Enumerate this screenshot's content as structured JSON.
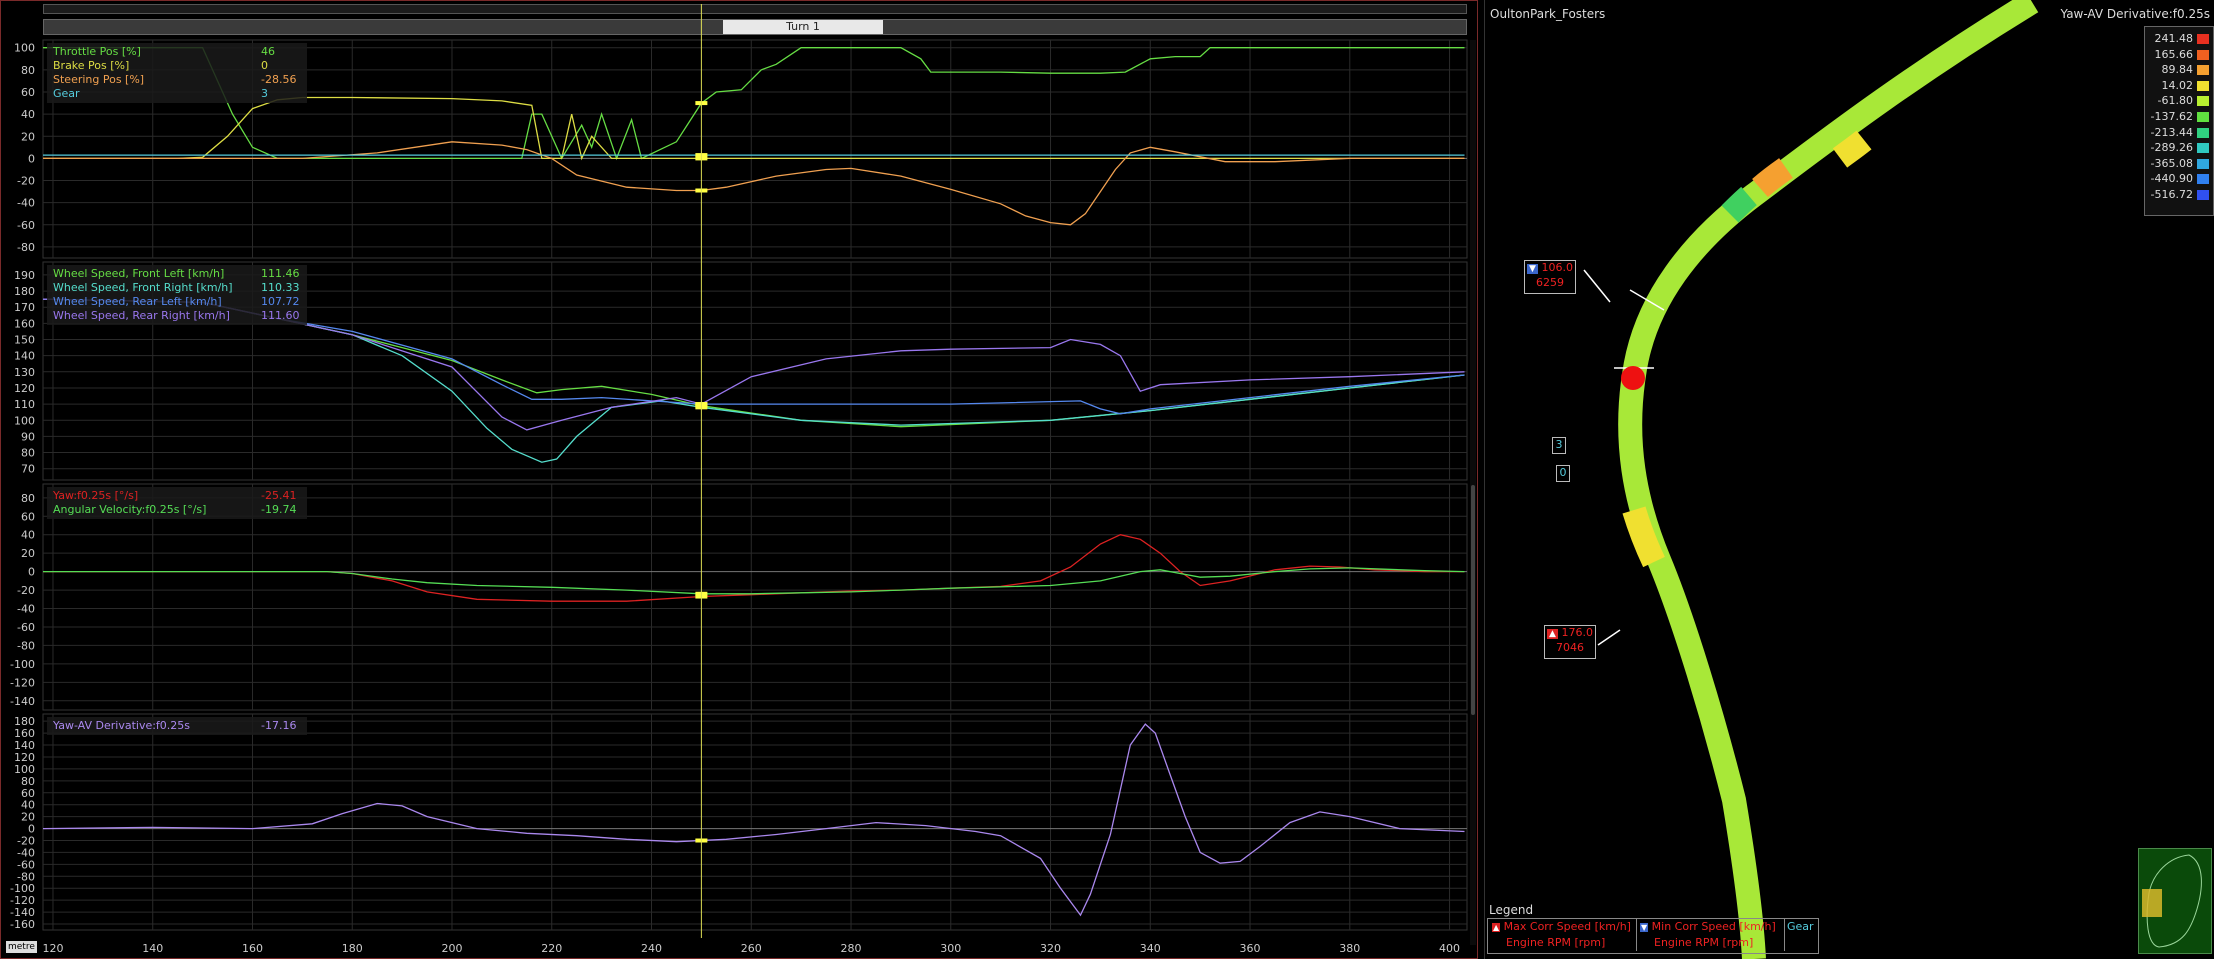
{
  "segment": {
    "label": "Turn 1"
  },
  "unit_label": "metre",
  "x_axis": {
    "ticks": [
      120,
      140,
      160,
      180,
      200,
      220,
      240,
      260,
      280,
      300,
      320,
      340,
      360,
      380,
      400
    ]
  },
  "charts": [
    {
      "id": "inputs",
      "yticks": [
        "100",
        "80",
        "60",
        "40",
        "20",
        "0",
        "-20",
        "-40",
        "-60",
        "-80"
      ],
      "ylim": [
        -90,
        107
      ],
      "legend": [
        {
          "name": "Throttle Pos [%]",
          "value": "46",
          "color": "#66dd44"
        },
        {
          "name": "Brake Pos [%]",
          "value": "0",
          "color": "#dddd44"
        },
        {
          "name": "Steering Pos [%]",
          "value": "-28.56",
          "color": "#f0a050"
        },
        {
          "name": "Gear",
          "value": "3",
          "color": "#55ccdd"
        }
      ],
      "series": [
        {
          "color": "#66dd44",
          "x": [
            118,
            150,
            152,
            156,
            160,
            165,
            168,
            172,
            185,
            200,
            210,
            214,
            216,
            218,
            222,
            226,
            228,
            230,
            233,
            236,
            238,
            245,
            250,
            253,
            258,
            262,
            265,
            270,
            275,
            290,
            294,
            296,
            300,
            310,
            320,
            325,
            330,
            335,
            340,
            345,
            350,
            352,
            360,
            380,
            403
          ],
          "y": [
            100,
            100,
            80,
            40,
            10,
            0,
            0,
            0,
            0,
            0,
            0,
            0,
            40,
            40,
            0,
            30,
            10,
            40,
            0,
            35,
            0,
            15,
            50,
            60,
            62,
            80,
            85,
            100,
            100,
            100,
            90,
            78,
            78,
            78,
            77,
            77,
            77,
            78,
            90,
            92,
            92,
            100,
            100,
            100,
            100
          ]
        },
        {
          "color": "#dddd44",
          "x": [
            118,
            145,
            150,
            155,
            160,
            165,
            170,
            180,
            200,
            210,
            216,
            218,
            222,
            224,
            226,
            228,
            232,
            240,
            250,
            300,
            403
          ],
          "y": [
            0,
            0,
            1,
            20,
            45,
            53,
            55,
            55,
            54,
            52,
            48,
            0,
            0,
            40,
            0,
            20,
            0,
            0,
            0,
            0,
            0
          ]
        },
        {
          "color": "#f0a050",
          "x": [
            118,
            170,
            185,
            200,
            210,
            215,
            220,
            225,
            235,
            245,
            250,
            255,
            265,
            275,
            280,
            290,
            300,
            310,
            315,
            320,
            324,
            327,
            330,
            333,
            336,
            340,
            345,
            355,
            365,
            380,
            403
          ],
          "y": [
            0,
            0,
            5,
            15,
            12,
            8,
            0,
            -15,
            -26,
            -29,
            -29,
            -26,
            -16,
            -10,
            -9,
            -16,
            -28,
            -41,
            -52,
            -58,
            -60,
            -50,
            -30,
            -10,
            5,
            10,
            6,
            -3,
            -3,
            0,
            0
          ]
        },
        {
          "color": "#55ccdd",
          "x": [
            118,
            403
          ],
          "y": [
            3,
            3
          ]
        }
      ]
    },
    {
      "id": "wheels",
      "yticks": [
        "190",
        "180",
        "170",
        "160",
        "150",
        "140",
        "130",
        "120",
        "110",
        "100",
        "90",
        "80",
        "70"
      ],
      "ylim": [
        63,
        198
      ],
      "legend": [
        {
          "name": "Wheel Speed, Front Left [km/h]",
          "value": "111.46",
          "color": "#66dd44"
        },
        {
          "name": "Wheel Speed, Front Right [km/h]",
          "value": "110.33",
          "color": "#55ddcc"
        },
        {
          "name": "Wheel Speed, Rear Left [km/h]",
          "value": "107.72",
          "color": "#5588ee"
        },
        {
          "name": "Wheel Speed, Rear Right [km/h]",
          "value": "111.60",
          "color": "#9977ee"
        }
      ],
      "series": [
        {
          "color": "#66dd44",
          "x": [
            118,
            150,
            165,
            180,
            190,
            200,
            210,
            217,
            222,
            230,
            240,
            250,
            270,
            290,
            320,
            340,
            360,
            380,
            403
          ],
          "y": [
            175,
            173,
            163,
            153,
            145,
            137,
            125,
            117,
            119,
            121,
            116,
            109,
            100,
            96,
            100,
            106,
            113,
            120,
            128
          ]
        },
        {
          "color": "#55ddcc",
          "x": [
            118,
            150,
            165,
            180,
            190,
            200,
            207,
            212,
            218,
            221,
            225,
            232,
            242,
            250,
            270,
            290,
            320,
            340,
            360,
            380,
            403
          ],
          "y": [
            175,
            173,
            163,
            153,
            140,
            118,
            95,
            82,
            74,
            76,
            90,
            108,
            112,
            108,
            100,
            97,
            100,
            106,
            113,
            120,
            128
          ]
        },
        {
          "color": "#5588ee",
          "x": [
            118,
            150,
            165,
            180,
            200,
            210,
            216,
            222,
            230,
            240,
            250,
            300,
            326,
            330,
            334,
            340,
            360,
            380,
            403
          ],
          "y": [
            175,
            173,
            163,
            155,
            138,
            122,
            113,
            113,
            114,
            112,
            110,
            110,
            112,
            107,
            104,
            107,
            114,
            121,
            128
          ]
        },
        {
          "color": "#9977ee",
          "x": [
            118,
            150,
            165,
            180,
            200,
            210,
            215,
            222,
            232,
            245,
            250,
            260,
            275,
            290,
            300,
            320,
            324,
            330,
            334,
            338,
            342,
            360,
            380,
            403
          ],
          "y": [
            175,
            173,
            163,
            153,
            133,
            102,
            94,
            100,
            108,
            114,
            110,
            127,
            138,
            143,
            144,
            145,
            150,
            147,
            140,
            118,
            122,
            125,
            127,
            130
          ]
        }
      ]
    },
    {
      "id": "yaw",
      "yticks": [
        "80",
        "60",
        "40",
        "20",
        "0",
        "-20",
        "-40",
        "-60",
        "-80",
        "-100",
        "-120",
        "-140"
      ],
      "ylim": [
        -150,
        95
      ],
      "legend": [
        {
          "name": "Yaw:f0.25s [°/s]",
          "value": "-25.41",
          "color": "#dd2222"
        },
        {
          "name": "Angular Velocity:f0.25s [°/s]",
          "value": "-19.74",
          "color": "#55dd55"
        }
      ],
      "series": [
        {
          "color": "#dd2222",
          "x": [
            118,
            175,
            180,
            188,
            195,
            205,
            220,
            235,
            250,
            260,
            270,
            280,
            290,
            300,
            310,
            318,
            324,
            330,
            334,
            338,
            342,
            346,
            350,
            356,
            365,
            372,
            378,
            385,
            395,
            403
          ],
          "y": [
            0,
            0,
            -2,
            -10,
            -22,
            -30,
            -32,
            -32,
            -27,
            -25,
            -23,
            -21,
            -20,
            -18,
            -16,
            -10,
            5,
            30,
            40,
            35,
            20,
            0,
            -15,
            -10,
            2,
            6,
            5,
            2,
            0,
            0
          ]
        },
        {
          "color": "#55dd55",
          "x": [
            118,
            175,
            180,
            188,
            195,
            205,
            220,
            235,
            250,
            260,
            270,
            280,
            290,
            300,
            320,
            330,
            338,
            342,
            346,
            350,
            356,
            365,
            372,
            380,
            395,
            403
          ],
          "y": [
            0,
            0,
            -2,
            -8,
            -12,
            -15,
            -17,
            -20,
            -24,
            -24,
            -23,
            -22,
            -20,
            -18,
            -15,
            -10,
            0,
            2,
            -2,
            -6,
            -5,
            0,
            3,
            4,
            1,
            0
          ]
        }
      ]
    },
    {
      "id": "deriv",
      "yticks": [
        "180",
        "160",
        "140",
        "120",
        "100",
        "80",
        "60",
        "40",
        "20",
        "0",
        "-20",
        "-40",
        "-60",
        "-80",
        "-100",
        "-120",
        "-140",
        "-160"
      ],
      "ylim": [
        -170,
        192
      ],
      "legend": [
        {
          "name": "Yaw-AV Derivative:f0.25s",
          "value": "-17.16",
          "color": "#aa88ee"
        }
      ],
      "series": [
        {
          "color": "#aa88ee",
          "x": [
            118,
            140,
            160,
            172,
            178,
            185,
            190,
            195,
            205,
            215,
            225,
            235,
            245,
            255,
            265,
            275,
            285,
            295,
            305,
            310,
            318,
            322,
            326,
            328,
            332,
            336,
            339,
            341,
            344,
            347,
            350,
            354,
            358,
            362,
            368,
            374,
            380,
            390,
            403
          ],
          "y": [
            0,
            2,
            0,
            8,
            25,
            42,
            38,
            20,
            0,
            -8,
            -12,
            -18,
            -22,
            -18,
            -10,
            0,
            10,
            5,
            -5,
            -12,
            -50,
            -100,
            -145,
            -110,
            -10,
            140,
            175,
            160,
            90,
            20,
            -40,
            -58,
            -55,
            -30,
            10,
            28,
            20,
            0,
            -5
          ]
        }
      ]
    }
  ],
  "cursor": {
    "x": 250
  },
  "map": {
    "track": "OultonPark_Fosters",
    "channel": "Yaw-AV Derivative:f0.25s",
    "scale": [
      {
        "v": "241.48",
        "c": "#e83020"
      },
      {
        "v": "165.66",
        "c": "#f06020"
      },
      {
        "v": "89.84",
        "c": "#f5a030"
      },
      {
        "v": "14.02",
        "c": "#f0e030"
      },
      {
        "v": "-61.80",
        "c": "#b8f030"
      },
      {
        "v": "-137.62",
        "c": "#60e040"
      },
      {
        "v": "-213.44",
        "c": "#30d080"
      },
      {
        "v": "-289.26",
        "c": "#30c8c0"
      },
      {
        "v": "-365.08",
        "c": "#30a8e0"
      },
      {
        "v": "-440.90",
        "c": "#3080f0"
      },
      {
        "v": "-516.72",
        "c": "#3050f0"
      }
    ],
    "min_corner": {
      "speed": "106.0",
      "rpm": "6259"
    },
    "max_corner": {
      "speed": "176.0",
      "rpm": "7046"
    },
    "gear_marks": [
      "3",
      "0"
    ],
    "legend_title": "Legend",
    "legend": {
      "max_speed": "Max Corr Speed [km/h]",
      "max_rpm": "Engine RPM [rpm]",
      "min_speed": "Min Corr Speed [km/h]",
      "min_rpm": "Engine RPM [rpm]",
      "gear": "Gear"
    }
  }
}
